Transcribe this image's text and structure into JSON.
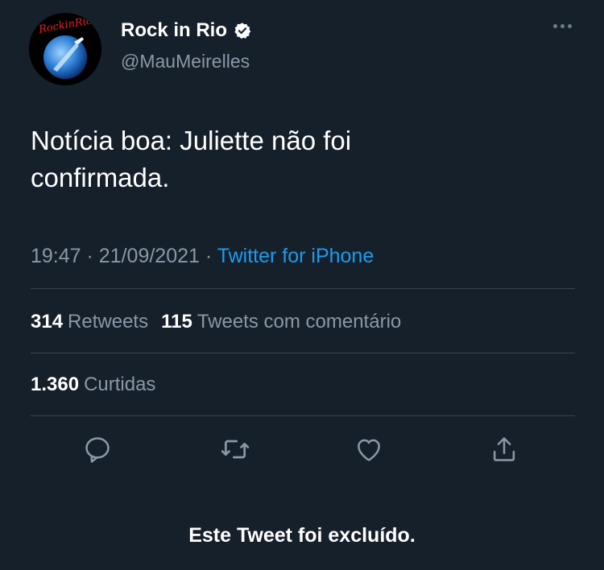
{
  "colors": {
    "background": "#15202b",
    "text_primary": "#ffffff",
    "text_secondary": "#8b98a5",
    "accent": "#1d9bf0",
    "divider": "#38444d",
    "verified_badge": "#ffffff"
  },
  "author": {
    "display_name": "Rock in Rio",
    "handle": "@MauMeirelles",
    "verified": true,
    "avatar_icon": "rock-in-rio-logo",
    "avatar_logo_text": "RockinRio"
  },
  "tweet": {
    "text": "Notícia boa: Juliette não foi\nconfirmada.",
    "time": "19:47",
    "separator": "·",
    "date": "21/09/2021",
    "source": "Twitter for iPhone"
  },
  "stats": {
    "retweets_count": "314",
    "retweets_label": "Retweets",
    "quotes_count": "115",
    "quotes_label": "Tweets com comentário",
    "likes_count": "1.360",
    "likes_label": "Curtidas"
  },
  "actions": [
    {
      "name": "reply",
      "icon": "speech-bubble-icon"
    },
    {
      "name": "retweet",
      "icon": "retweet-arrows-icon"
    },
    {
      "name": "like",
      "icon": "heart-icon"
    },
    {
      "name": "share",
      "icon": "share-upload-icon"
    }
  ],
  "footer": {
    "deleted_notice": "Este Tweet foi excluído."
  }
}
